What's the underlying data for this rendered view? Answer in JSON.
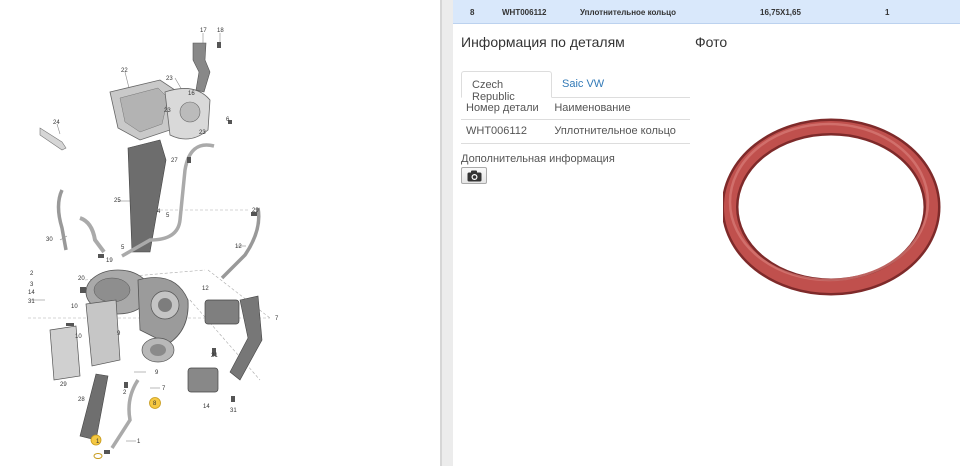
{
  "selected_row": {
    "number": "8",
    "part_number": "WHT006112",
    "name": "Уплотнительное кольцо",
    "size": "16,75X1,65",
    "quantity": "1"
  },
  "details": {
    "heading": "Информация по деталям",
    "photo_heading": "Фото",
    "tabs": [
      {
        "label": "Czech Republic",
        "active": true
      },
      {
        "label": "Saic VW",
        "active": false
      }
    ],
    "table": {
      "headers": [
        "Номер детали",
        "Наименование"
      ],
      "rows": [
        [
          "WHT006112",
          "Уплотнительное кольцо"
        ]
      ]
    },
    "extra_info": "Дополнительная информация",
    "camera_icon": "camera-icon"
  },
  "diagram": {
    "callouts": [
      "17",
      "18",
      "22",
      "23",
      "24",
      "25",
      "26",
      "27",
      "28",
      "29",
      "30",
      "12",
      "14",
      "31",
      "7",
      "9",
      "1",
      "6",
      "4",
      "2",
      "3",
      "5",
      "10",
      "11",
      "13",
      "15",
      "8"
    ],
    "highlight_color": "#f5c842"
  },
  "photo": {
    "subject": "o-ring",
    "color": "#c0504d"
  }
}
